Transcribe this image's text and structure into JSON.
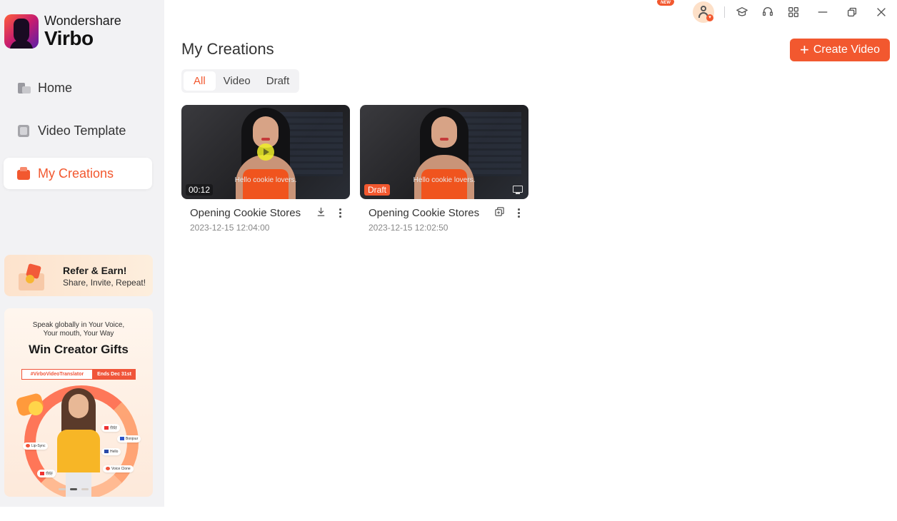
{
  "brand": {
    "company": "Wondershare",
    "product": "Virbo"
  },
  "sidebar": {
    "items": [
      {
        "label": "Home",
        "icon": "home-icon"
      },
      {
        "label": "Video Template",
        "icon": "template-icon"
      },
      {
        "label": "My Creations",
        "icon": "creations-icon",
        "active": true
      }
    ],
    "refer": {
      "title": "Refer & Earn!",
      "subtitle": "Share, Invite, Repeat!"
    },
    "promo": {
      "line1": "Speak globally in Your Voice,",
      "line2": "Your mouth, Your Way",
      "headline": "Win Creator Gifts",
      "hashtag": "#VirboVideoTranslator",
      "deadline": "Ends Dec 31st",
      "chip_lip": "Lip-Sync",
      "chip_voice": "Voice Clone",
      "chip_c1": "你好",
      "chip_c2": "Bonjour",
      "chip_c3": "Hello",
      "chip_c4": "你好"
    }
  },
  "topbar": {
    "new_badge": "NEW"
  },
  "main": {
    "title": "My Creations",
    "create_label": "Create Video",
    "tabs": [
      {
        "label": "All",
        "active": true
      },
      {
        "label": "Video"
      },
      {
        "label": "Draft"
      }
    ],
    "cards": [
      {
        "title": "Opening Cookie Stores",
        "date": "2023-12-15 12:04:00",
        "badge": "00:12",
        "caption": "Hello cookie lovers."
      },
      {
        "title": "Opening Cookie Stores",
        "date": "2023-12-15 12:02:50",
        "badge": "Draft",
        "caption": "Hello cookie lovers."
      }
    ]
  },
  "colors": {
    "accent": "#f2582f",
    "sidebar_bg": "#f2f2f4"
  }
}
